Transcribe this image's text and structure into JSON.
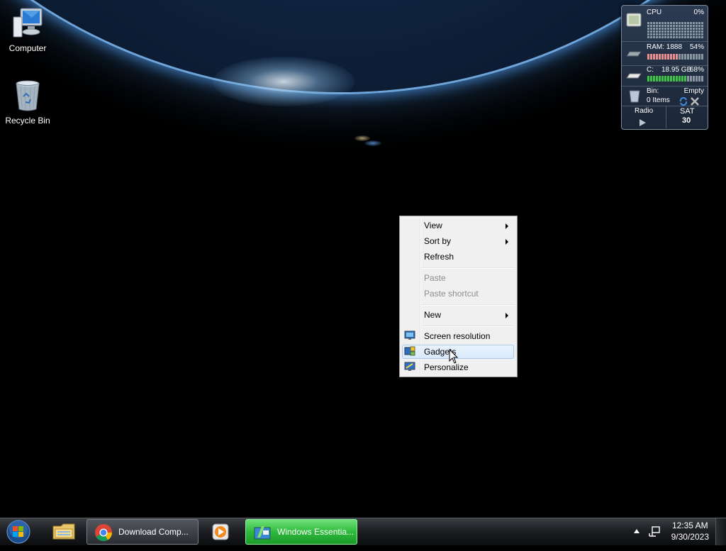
{
  "desktop_icons": [
    {
      "label": "Computer",
      "icon": "computer-icon"
    },
    {
      "label": "Recycle Bin",
      "icon": "recycle-bin-icon"
    }
  ],
  "gadget": {
    "cpu_label": "CPU",
    "cpu_value": "0%",
    "cpu_percent": 0,
    "ram_label": "RAM: 1888",
    "ram_value": "54%",
    "ram_percent": 54,
    "disk_label": "C:",
    "disk_size": "18.95 GB",
    "disk_value": "68%",
    "disk_percent": 68,
    "bin_label": "Bin:",
    "bin_status": "Empty",
    "bin_items": "0 Items",
    "radio_label": "Radio",
    "day_label": "SAT",
    "day_number": "30"
  },
  "context_menu": {
    "items": [
      {
        "label": "View",
        "submenu": true,
        "disabled": false
      },
      {
        "label": "Sort by",
        "submenu": true,
        "disabled": false
      },
      {
        "label": "Refresh",
        "submenu": false,
        "disabled": false
      },
      {
        "label": "Paste",
        "submenu": false,
        "disabled": true
      },
      {
        "label": "Paste shortcut",
        "submenu": false,
        "disabled": true
      },
      {
        "label": "New",
        "submenu": true,
        "disabled": false
      },
      {
        "label": "Screen resolution",
        "submenu": false,
        "disabled": false,
        "icon": "screen-resolution-icon"
      },
      {
        "label": "Gadgets",
        "submenu": false,
        "disabled": false,
        "icon": "gadgets-icon",
        "highlighted": true
      },
      {
        "label": "Personalize",
        "submenu": false,
        "disabled": false,
        "icon": "personalize-icon"
      }
    ]
  },
  "taskbar": {
    "buttons": [
      {
        "label": "",
        "icon": "file-explorer-icon"
      },
      {
        "label": "Download Comp...",
        "icon": "chrome-icon"
      },
      {
        "label": "",
        "icon": "media-player-icon"
      },
      {
        "label": "Windows Essentia...",
        "icon": "windows-essentials-icon"
      }
    ],
    "clock_time": "12:35 AM",
    "clock_date": "9/30/2023"
  },
  "colors": {
    "menu_bg": "#f0f0f0",
    "highlight": "#d9e9fb",
    "active_task": "#3cc84a",
    "gadget_bg": "#1b2636"
  }
}
